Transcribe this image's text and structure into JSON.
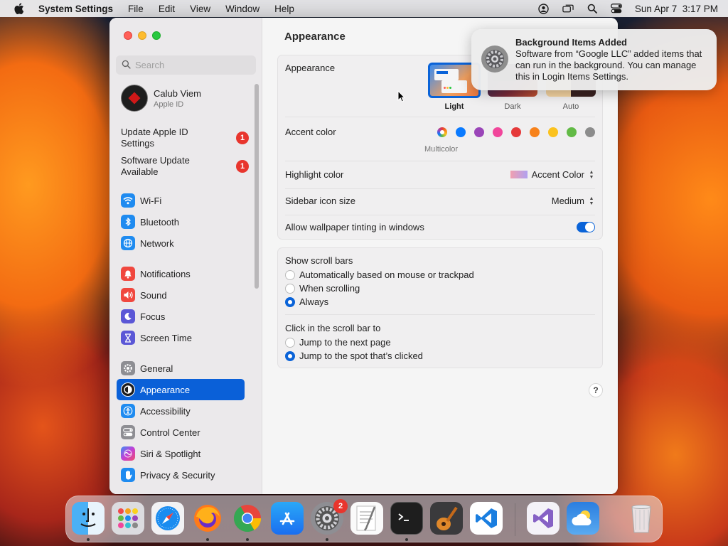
{
  "menubar": {
    "app_name": "System Settings",
    "menus": [
      "File",
      "Edit",
      "View",
      "Window",
      "Help"
    ],
    "clock": "Sun Apr 7  3:17 PM"
  },
  "sidebar": {
    "search_placeholder": "Search",
    "profile": {
      "name": "Calub Viem",
      "subtitle": "Apple ID"
    },
    "updates": [
      {
        "label": "Update Apple ID Settings",
        "badge": "1"
      },
      {
        "label": "Software Update Available",
        "badge": "1"
      }
    ],
    "items": [
      {
        "label": "Wi-Fi",
        "icon": "wifi-icon",
        "color": "#1f8bf0"
      },
      {
        "label": "Bluetooth",
        "icon": "bluetooth-icon",
        "color": "#1f8bf0"
      },
      {
        "label": "Network",
        "icon": "globe-icon",
        "color": "#1f8bf0"
      },
      {
        "label": "Notifications",
        "icon": "bell-icon",
        "color": "#f0473e"
      },
      {
        "label": "Sound",
        "icon": "speaker-icon",
        "color": "#f0473e"
      },
      {
        "label": "Focus",
        "icon": "moon-icon",
        "color": "#5b57d6"
      },
      {
        "label": "Screen Time",
        "icon": "hourglass-icon",
        "color": "#5b57d6"
      },
      {
        "label": "General",
        "icon": "gear-icon",
        "color": "#8e8e93"
      },
      {
        "label": "Appearance",
        "icon": "appearance-icon",
        "color": "#1c1c1e"
      },
      {
        "label": "Accessibility",
        "icon": "accessibility-icon",
        "color": "#1f8bf0"
      },
      {
        "label": "Control Center",
        "icon": "control-center-icon",
        "color": "#8e8e93"
      },
      {
        "label": "Siri & Spotlight",
        "icon": "siri-icon",
        "color": "#b04ad8"
      },
      {
        "label": "Privacy & Security",
        "icon": "hand-icon",
        "color": "#1f8bf0"
      }
    ],
    "active_item": "Appearance"
  },
  "content": {
    "title": "Appearance",
    "appearance": {
      "label": "Appearance",
      "options": [
        "Light",
        "Dark",
        "Auto"
      ],
      "selected": "Light"
    },
    "accent": {
      "label": "Accent color",
      "colors": [
        "#6b6bff",
        "#0a7aff",
        "#9a45b8",
        "#f1469b",
        "#e5393a",
        "#f7821b",
        "#fbc21e",
        "#62ba46",
        "#8c8c8c"
      ],
      "caption": "Multicolor"
    },
    "highlight": {
      "label": "Highlight color",
      "value": "Accent Color"
    },
    "sidebar_icon": {
      "label": "Sidebar icon size",
      "value": "Medium"
    },
    "tinting": {
      "label": "Allow wallpaper tinting in windows",
      "on": true
    },
    "scrollbars": {
      "label": "Show scroll bars",
      "options": [
        "Automatically based on mouse or trackpad",
        "When scrolling",
        "Always"
      ],
      "selected": "Always"
    },
    "click": {
      "label": "Click in the scroll bar to",
      "options": [
        "Jump to the next page",
        "Jump to the spot that’s clicked"
      ],
      "selected": "Jump to the spot that’s clicked"
    },
    "help": "?"
  },
  "notification": {
    "title": "Background Items Added",
    "body": "Software from “Google LLC” added items that can run in the background. You can manage this in Login Items Settings."
  },
  "dock": {
    "apps": [
      {
        "name": "Finder",
        "icon": "finder-icon"
      },
      {
        "name": "Launchpad",
        "icon": "launchpad-icon"
      },
      {
        "name": "Safari",
        "icon": "safari-icon"
      },
      {
        "name": "Firefox",
        "icon": "firefox-icon"
      },
      {
        "name": "Chrome",
        "icon": "chrome-icon"
      },
      {
        "name": "App Store",
        "icon": "app-store-icon"
      },
      {
        "name": "System Settings",
        "icon": "system-settings-icon",
        "badge": "2"
      },
      {
        "name": "TextEdit",
        "icon": "textedit-icon"
      },
      {
        "name": "Terminal",
        "icon": "terminal-icon"
      },
      {
        "name": "GarageBand",
        "icon": "garageband-icon"
      },
      {
        "name": "VS Code",
        "icon": "vscode-icon"
      },
      {
        "name": "Visual Studio",
        "icon": "visual-studio-icon"
      },
      {
        "name": "Weather",
        "icon": "weather-icon"
      },
      {
        "name": "Trash",
        "icon": "trash-icon"
      }
    ]
  }
}
